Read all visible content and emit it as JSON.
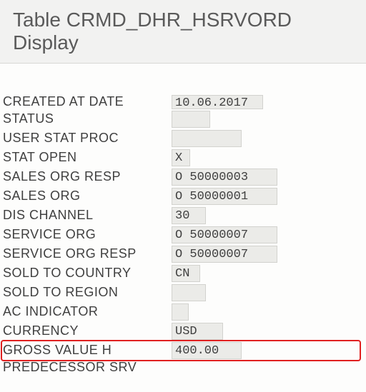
{
  "header": {
    "title": "Table CRMD_DHR_HSRVORD Display"
  },
  "fields": {
    "created_at_date": {
      "label": "CREATED AT DATE",
      "value": "10.06.2017"
    },
    "status": {
      "label": "STATUS",
      "value": ""
    },
    "user_stat_proc": {
      "label": "USER STAT PROC",
      "value": ""
    },
    "stat_open": {
      "label": "STAT OPEN",
      "value": "X"
    },
    "sales_org_resp": {
      "label": "SALES ORG RESP",
      "value": "O 50000003"
    },
    "sales_org": {
      "label": "SALES ORG",
      "value": "O 50000001"
    },
    "dis_channel": {
      "label": "DIS CHANNEL",
      "value": "30"
    },
    "service_org": {
      "label": "SERVICE ORG",
      "value": "O 50000007"
    },
    "service_org_resp": {
      "label": "SERVICE ORG RESP",
      "value": "O 50000007"
    },
    "sold_to_country": {
      "label": "SOLD TO COUNTRY",
      "value": "CN"
    },
    "sold_to_region": {
      "label": "SOLD TO REGION",
      "value": ""
    },
    "ac_indicator": {
      "label": "AC INDICATOR",
      "value": ""
    },
    "currency": {
      "label": "CURRENCY",
      "value": "USD"
    },
    "gross_value_h": {
      "label": "GROSS VALUE H",
      "value": "400.00"
    },
    "predecessor_srv": {
      "label": "PREDECESSOR SRV",
      "value": ""
    }
  }
}
